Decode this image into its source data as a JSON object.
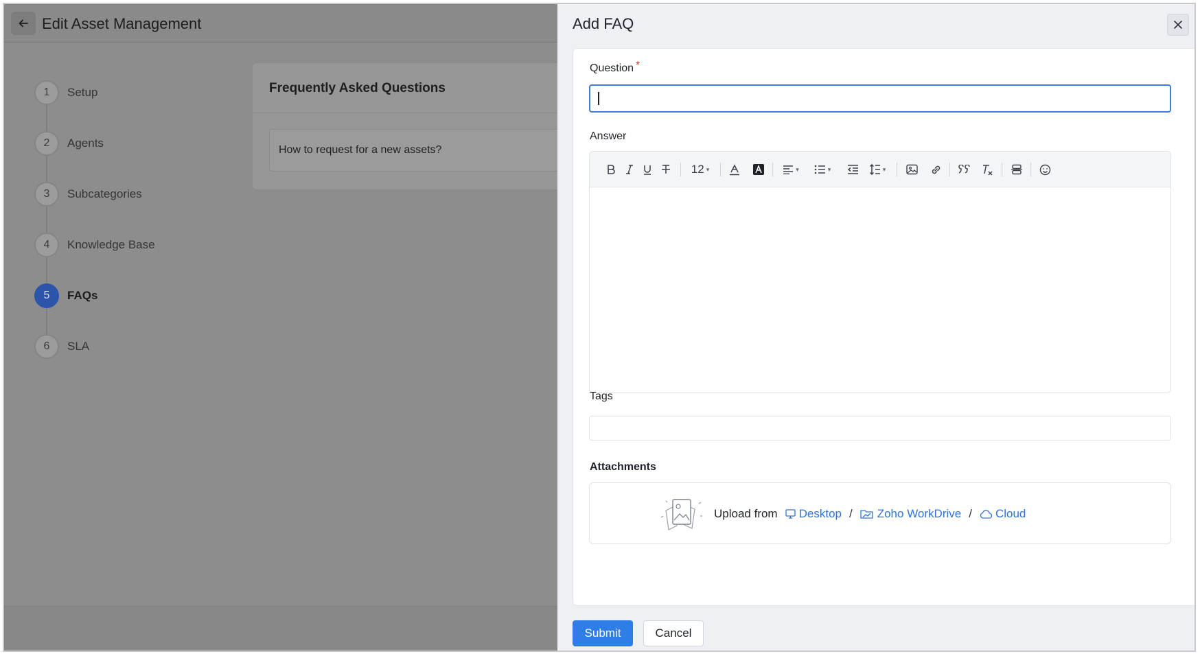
{
  "page": {
    "title": "Edit Asset Management",
    "back_icon": "arrow-left-icon"
  },
  "steps": [
    {
      "num": "1",
      "label": "Setup"
    },
    {
      "num": "2",
      "label": "Agents"
    },
    {
      "num": "3",
      "label": "Subcategories"
    },
    {
      "num": "4",
      "label": "Knowledge Base"
    },
    {
      "num": "5",
      "label": "FAQs",
      "active": true
    },
    {
      "num": "6",
      "label": "SLA"
    }
  ],
  "faq_panel": {
    "title": "Frequently Asked Questions",
    "items": [
      "How to request for a new assets?"
    ]
  },
  "drawer": {
    "title": "Add FAQ",
    "close_icon": "close-icon",
    "question_label": "Question",
    "required_mark": "*",
    "question_value": "",
    "answer_label": "Answer",
    "toolbar": {
      "font_size": "12",
      "tools": [
        "bold-icon",
        "italic-icon",
        "underline-icon",
        "strikethrough-icon",
        "font-size-select",
        "text-color-icon",
        "highlight-color-icon",
        "align-icon",
        "list-icon",
        "outdent-icon",
        "line-height-icon",
        "insert-image-icon",
        "insert-link-icon",
        "blockquote-icon",
        "clear-format-icon",
        "insert-block-icon",
        "emoji-icon"
      ]
    },
    "tags_label": "Tags",
    "attachments_label": "Attachments",
    "upload": {
      "prefix": "Upload from",
      "desktop": "Desktop",
      "workdrive": "Zoho WorkDrive",
      "cloud": "Cloud",
      "separator": "/"
    },
    "submit_label": "Submit",
    "cancel_label": "Cancel"
  },
  "colors": {
    "accent": "#2f7de6",
    "link": "#2d73d9",
    "active_step": "#2b55a8",
    "required": "#e0322e",
    "overlay": "#8d8d8d"
  }
}
